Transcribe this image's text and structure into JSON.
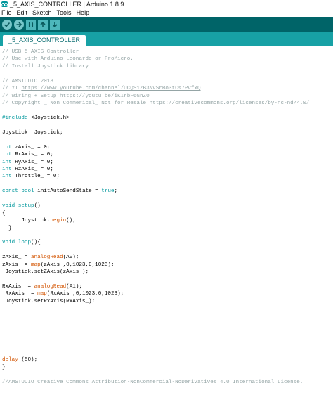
{
  "window": {
    "title": "_5_AXIS_CONTROLLER | Arduino 1.8.9",
    "icon": "arduino-logo-icon"
  },
  "menu": [
    "File",
    "Edit",
    "Sketch",
    "Tools",
    "Help"
  ],
  "toolbar": {
    "buttons": [
      {
        "name": "verify-button",
        "icon": "check-icon"
      },
      {
        "name": "upload-button",
        "icon": "arrow-right-icon"
      },
      {
        "name": "new-button",
        "icon": "new-file-icon"
      },
      {
        "name": "open-button",
        "icon": "arrow-up-icon"
      },
      {
        "name": "save-button",
        "icon": "arrow-down-icon"
      }
    ]
  },
  "tab": {
    "label": "_5_AXIS_CONTROLLER"
  },
  "colors": {
    "toolbar_bg": "#006468",
    "tab_strip_bg": "#17a1a5",
    "comment": "#95a5a6",
    "keyword": "#00979c",
    "function": "#d35400"
  },
  "code_lines": [
    [
      {
        "t": "// USB 5 AXIS Controller",
        "c": "cmt"
      }
    ],
    [
      {
        "t": "// Use with Arduino Leonardo or ProMicro.",
        "c": "cmt"
      }
    ],
    [
      {
        "t": "// Install Joystick library",
        "c": "cmt"
      }
    ],
    [],
    [
      {
        "t": "// AMSTUDIO 2018",
        "c": "cmt"
      }
    ],
    [
      {
        "t": "// YT ",
        "c": "cmt"
      },
      {
        "t": "https://www.youtube.com/channel/UCQS1ZB3NVSrBo3tCs7PvfxQ",
        "c": "url"
      }
    ],
    [
      {
        "t": "// Wiring + Setup ",
        "c": "cmt"
      },
      {
        "t": "https://youtu.be/iKIrbF6GnZ0",
        "c": "url"
      }
    ],
    [
      {
        "t": "// Copyright _ Non Commerical_ Not for Resale ",
        "c": "cmt"
      },
      {
        "t": "https://creativecommons.org/licenses/by-nc-nd/4.0/",
        "c": "url"
      }
    ],
    [],
    [
      {
        "t": "#include ",
        "c": "kw"
      },
      {
        "t": "<Joystick.h>",
        "c": ""
      }
    ],
    [],
    [
      {
        "t": "Joystick_ Joystick;",
        "c": ""
      }
    ],
    [],
    [
      {
        "t": "int",
        "c": "kw"
      },
      {
        "t": " zAxis_ = 0;",
        "c": ""
      }
    ],
    [
      {
        "t": "int",
        "c": "kw"
      },
      {
        "t": " RxAxis_ = 0;",
        "c": ""
      }
    ],
    [
      {
        "t": "int",
        "c": "kw"
      },
      {
        "t": " RyAxis_ = 0;",
        "c": ""
      }
    ],
    [
      {
        "t": "int",
        "c": "kw"
      },
      {
        "t": " RzAxis_ = 0;",
        "c": ""
      }
    ],
    [
      {
        "t": "int",
        "c": "kw"
      },
      {
        "t": " Throttle_ = 0;",
        "c": ""
      }
    ],
    [],
    [
      {
        "t": "const",
        "c": "kw"
      },
      {
        "t": " ",
        "c": ""
      },
      {
        "t": "bool",
        "c": "kw"
      },
      {
        "t": " initAutoSendState = ",
        "c": ""
      },
      {
        "t": "true",
        "c": "kw"
      },
      {
        "t": ";",
        "c": ""
      }
    ],
    [],
    [
      {
        "t": "void",
        "c": "kw"
      },
      {
        "t": " ",
        "c": ""
      },
      {
        "t": "setup",
        "c": "kw"
      },
      {
        "t": "()",
        "c": ""
      }
    ],
    [
      {
        "t": "{",
        "c": ""
      }
    ],
    [
      {
        "t": "      Joystick.",
        "c": ""
      },
      {
        "t": "begin",
        "c": "fn"
      },
      {
        "t": "();",
        "c": ""
      }
    ],
    [
      {
        "t": "  }",
        "c": ""
      }
    ],
    [],
    [
      {
        "t": "void",
        "c": "kw"
      },
      {
        "t": " ",
        "c": ""
      },
      {
        "t": "loop",
        "c": "kw"
      },
      {
        "t": "(){",
        "c": ""
      }
    ],
    [],
    [
      {
        "t": "zAxis_ = ",
        "c": ""
      },
      {
        "t": "analogRead",
        "c": "fn"
      },
      {
        "t": "(A0);",
        "c": ""
      }
    ],
    [
      {
        "t": "zAxis_ = ",
        "c": ""
      },
      {
        "t": "map",
        "c": "fn"
      },
      {
        "t": "(zAxis_,0,1023,0,1023);",
        "c": ""
      }
    ],
    [
      {
        "t": " Joystick.setZAxis(zAxis_);",
        "c": ""
      }
    ],
    [],
    [
      {
        "t": "RxAxis_ = ",
        "c": ""
      },
      {
        "t": "analogRead",
        "c": "fn"
      },
      {
        "t": "(A1);",
        "c": ""
      }
    ],
    [
      {
        "t": " RxAxis_ = ",
        "c": ""
      },
      {
        "t": "map",
        "c": "fn"
      },
      {
        "t": "(RxAxis_,0,1023,0,1023);",
        "c": ""
      }
    ],
    [
      {
        "t": " Joystick.setRxAxis(RxAxis_);",
        "c": ""
      }
    ],
    [],
    [],
    [],
    [],
    [],
    [],
    [],
    [
      {
        "t": "delay",
        "c": "fn"
      },
      {
        "t": " (50);",
        "c": ""
      }
    ],
    [
      {
        "t": "}",
        "c": ""
      }
    ],
    [],
    [
      {
        "t": "//AMSTUDIO Creative Commons Attribution-NonCommercial-NoDerivatives 4.0 International License.",
        "c": "cmt"
      }
    ]
  ]
}
